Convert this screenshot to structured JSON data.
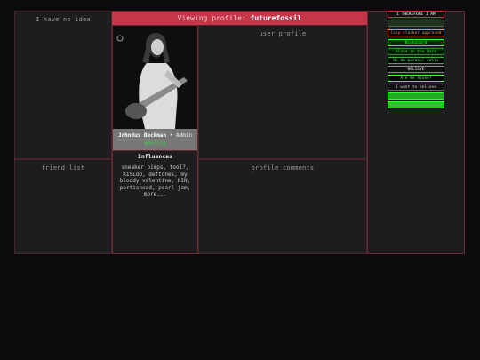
{
  "left": {
    "top_title": "I have no idea",
    "bottom_title": "friend list"
  },
  "header": {
    "prefix": "Viewing profile: ",
    "username": "futurefossil"
  },
  "profile": {
    "name": "Johndus Beckman",
    "role": "Admin",
    "status": "Online",
    "influences_title": "Influences",
    "influences_text": "sneaker pimps, tool?, KISLOO, deftones, my bloody valentine, NIN, portishead, pearl jam, more..."
  },
  "right": {
    "top_title": "user profile",
    "bottom_title": "profile comments"
  },
  "badges": [
    {
      "text": "I THEREFORE I AM",
      "bg": "#111111",
      "fg": "#ffffff",
      "border": "#cc3333"
    },
    {
      "text": "",
      "bg": "#223322",
      "fg": "#88ff88",
      "border": "#446644"
    },
    {
      "text": "Cozy slacker approved",
      "bg": "#000000",
      "fg": "#ff9933",
      "border": "#ff9933"
    },
    {
      "text": "Biohazard",
      "bg": "#003300",
      "fg": "#33ff33",
      "border": "#33ff33"
    },
    {
      "text": "Alone in the Dark",
      "bg": "#002200",
      "fg": "#55cc55",
      "border": "#338833"
    },
    {
      "text": "We do parasol cells",
      "bg": "#000000",
      "fg": "#66ff66",
      "border": "#44aa44"
    },
    {
      "text": "BELIEVE",
      "bg": "#111111",
      "fg": "#dddddd",
      "border": "#888888"
    },
    {
      "text": "Are We Alone?",
      "bg": "#000000",
      "fg": "#44ff44",
      "border": "#44ff44"
    },
    {
      "text": "I want to believe",
      "bg": "#111111",
      "fg": "#cccccc",
      "border": "#666666"
    },
    {
      "text": "",
      "bg": "#22aa22",
      "fg": "#003300",
      "border": "#33ff33"
    },
    {
      "text": "",
      "bg": "#22cc22",
      "fg": "#003300",
      "border": "#33ff33"
    }
  ]
}
